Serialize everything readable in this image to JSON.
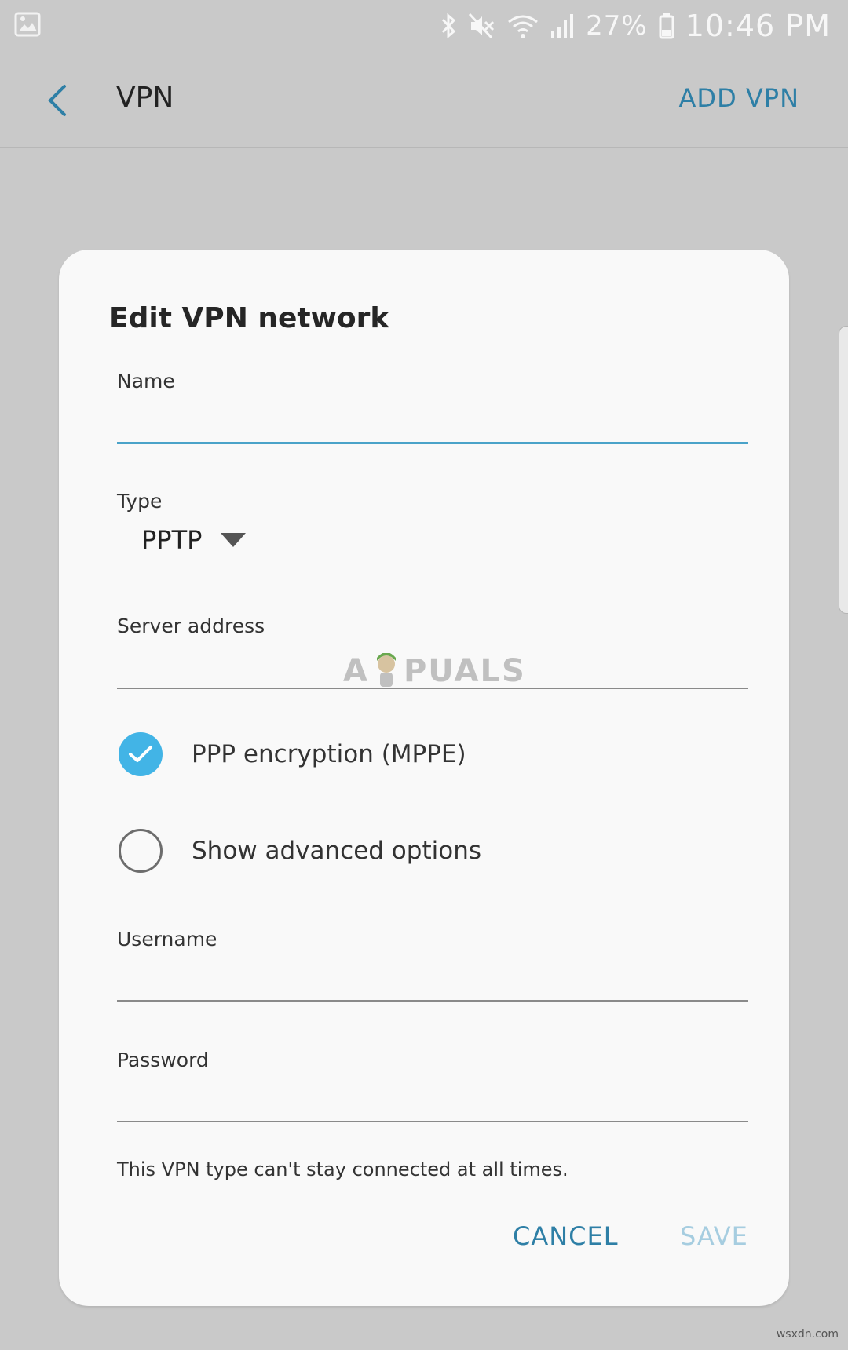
{
  "status_bar": {
    "battery_percent": "27%",
    "time": "10:46 PM",
    "icons": [
      "gallery-icon",
      "bluetooth-icon",
      "mute-icon",
      "wifi-icon",
      "signal-icon",
      "battery-icon"
    ]
  },
  "app_bar": {
    "title": "VPN",
    "action_label": "ADD VPN"
  },
  "dialog": {
    "title": "Edit VPN network",
    "name_label": "Name",
    "name_value": "",
    "type_label": "Type",
    "type_value": "PPTP",
    "server_label": "Server address",
    "server_value": "",
    "ppp_encryption_label": "PPP encryption (MPPE)",
    "ppp_encryption_checked": true,
    "advanced_label": "Show advanced options",
    "advanced_checked": false,
    "username_label": "Username",
    "username_value": "",
    "password_label": "Password",
    "password_value": "",
    "note": "This VPN type can't stay connected at all times.",
    "cancel_label": "CANCEL",
    "save_label": "SAVE"
  },
  "watermark": {
    "left": "A",
    "right": "PUALS"
  },
  "site_mark": "wsxdn.com",
  "colors": {
    "accent": "#2e7fa6",
    "check_on": "#42b4e6",
    "disabled": "#a6cde0",
    "background": "#c9c9c9",
    "dialog": "#f9f9f9"
  }
}
